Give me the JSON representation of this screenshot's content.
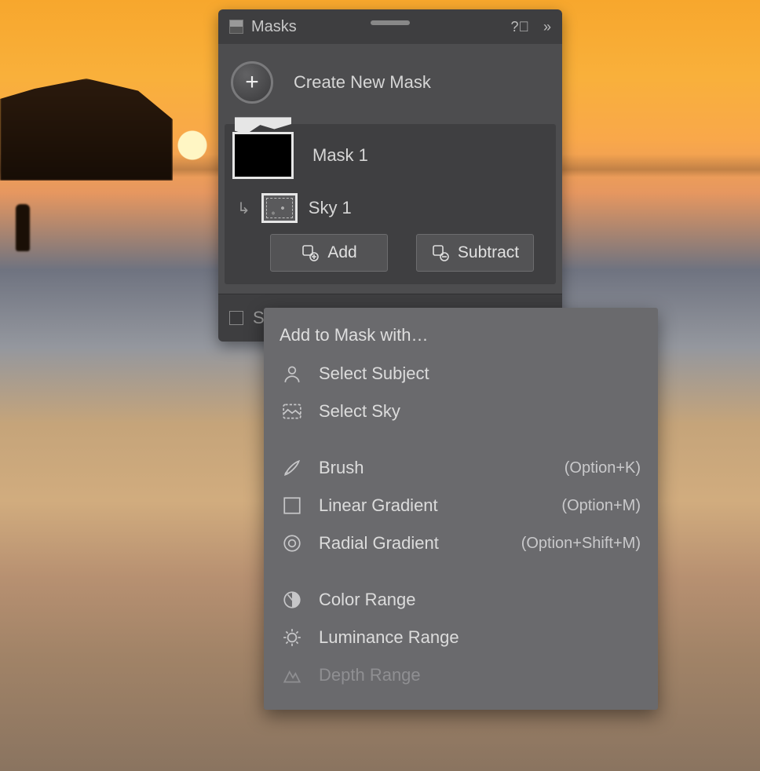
{
  "panel": {
    "title": "Masks",
    "create_label": "Create New Mask",
    "mask1": {
      "label": "Mask 1"
    },
    "sub1": {
      "label": "Sky 1"
    },
    "add_label": "Add",
    "subtract_label": "Subtract",
    "foot_partial": "S"
  },
  "menu": {
    "title": "Add to Mask with…",
    "items": {
      "select_subject": "Select Subject",
      "select_sky": "Select Sky",
      "brush": "Brush",
      "linear_gradient": "Linear Gradient",
      "radial_gradient": "Radial Gradient",
      "color_range": "Color Range",
      "luminance_range": "Luminance Range",
      "depth_range": "Depth Range"
    },
    "shortcuts": {
      "brush": "(Option+K)",
      "linear_gradient": "(Option+M)",
      "radial_gradient": "(Option+Shift+M)"
    }
  }
}
